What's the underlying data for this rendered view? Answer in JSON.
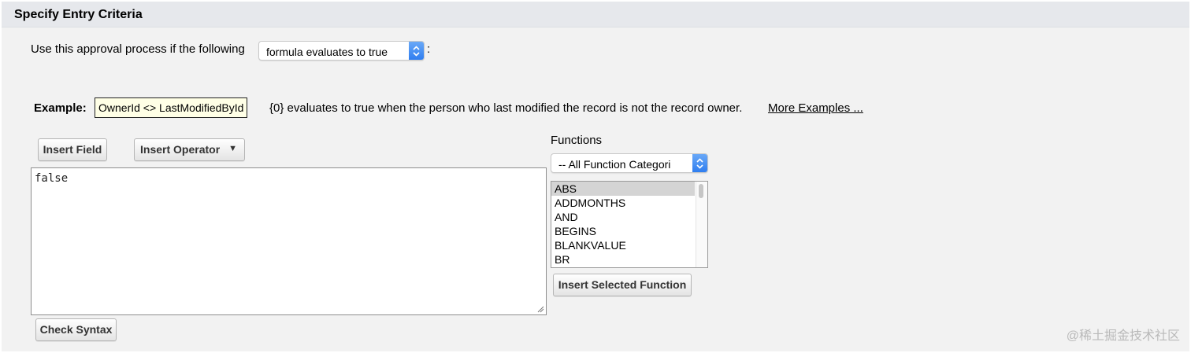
{
  "section": {
    "title": "Specify Entry Criteria"
  },
  "criteria": {
    "prefix": "Use this approval process if the following",
    "selected": "formula evaluates to true",
    "suffix": ":"
  },
  "example": {
    "label": "Example:",
    "formula": "OwnerId <> LastModifiedById",
    "description": "{0} evaluates to true when the person who last modified the record is not the record owner.",
    "more_link": "More Examples ..."
  },
  "toolbar": {
    "insert_field": "Insert Field",
    "insert_operator": "Insert Operator"
  },
  "editor": {
    "value": "false"
  },
  "functions": {
    "heading": "Functions",
    "category_selected": "-- All Function Categori",
    "items": [
      "ABS",
      "ADDMONTHS",
      "AND",
      "BEGINS",
      "BLANKVALUE",
      "BR"
    ],
    "selected_item": "ABS",
    "insert_selected": "Insert Selected Function"
  },
  "check_syntax": "Check Syntax",
  "watermark": "@稀土掘金技术社区"
}
